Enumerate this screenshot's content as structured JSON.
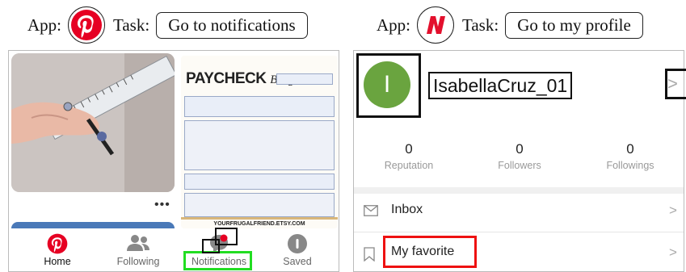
{
  "left_header": {
    "app_label": "App:",
    "task_label": "Task:",
    "task_text": "Go to notifications"
  },
  "right_header": {
    "app_label": "App:",
    "task_label": "Task:",
    "task_text": "Go to my profile"
  },
  "pinterest": {
    "more_label": "•••",
    "pin_paycheck": {
      "title_main": "PAYCHECK",
      "title_script": "Budget",
      "footer": "YOURFRUGALFRIEND.ETSY.COM"
    },
    "nav": [
      {
        "label": "Home",
        "icon": "pinterest-logo-icon",
        "active": true
      },
      {
        "label": "Following",
        "icon": "people-icon",
        "active": false
      },
      {
        "label": "Notifications",
        "icon": "speech-bubble-icon",
        "active": false
      },
      {
        "label": "Saved",
        "icon": "profile-icon",
        "active": false
      }
    ]
  },
  "nyt": {
    "avatar_letter": "I",
    "username": "IsabellaCruz_01",
    "stats": [
      {
        "value": "0",
        "label": "Reputation"
      },
      {
        "value": "0",
        "label": "Followers"
      },
      {
        "value": "0",
        "label": "Followings"
      }
    ],
    "rows": [
      {
        "label": "Inbox",
        "icon": "envelope-icon"
      },
      {
        "label": "My favorite",
        "icon": "bookmark-icon"
      }
    ],
    "chevron": ">"
  },
  "colors": {
    "pinterest_red": "#e60023",
    "nyt_red": "#e3102d",
    "avatar_green": "#6aa43f",
    "annotation_green": "#22dd22",
    "annotation_red": "#ee1111",
    "annotation_black": "#111111"
  }
}
